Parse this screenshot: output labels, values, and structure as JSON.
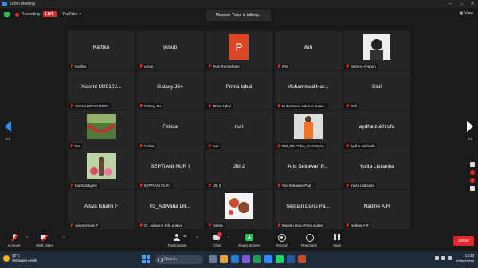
{
  "window": {
    "title": "Zoom Meeting"
  },
  "topbar": {
    "recording_label": "Recording",
    "live_label": "LIVE",
    "stream_target": "YouTube",
    "view_label": "View"
  },
  "talking_banner": "Munawir Yusuf is talking...",
  "pagination": {
    "left": "2/2",
    "right": "2/2"
  },
  "tiles": [
    {
      "name": "Kartika",
      "label": "Kartika",
      "thumb": null
    },
    {
      "name": "yusup",
      "label": "yusup",
      "thumb": null
    },
    {
      "name": "",
      "label": "Putri Ramadhani",
      "thumb": "letter-P"
    },
    {
      "name": "Win",
      "label": "Win",
      "thumb": null
    },
    {
      "name": "",
      "label": "Salmon Anggun",
      "thumb": "photo-woman"
    },
    {
      "name": "Xiaomi M2010J...",
      "label": "Xiaomi M2010J19SG",
      "thumb": null
    },
    {
      "name": "Galaxy J6+",
      "label": "Galaxy J6+",
      "thumb": null
    },
    {
      "name": "Prima Iqbal",
      "label": "Prima Iqbal",
      "thumb": null
    },
    {
      "name": "Muhammad Har...",
      "label": "Muhammad Haris Kurniaw...",
      "thumb": null
    },
    {
      "name": "Sisil",
      "label": "Sisil",
      "thumb": null
    },
    {
      "name": "",
      "label": "Era",
      "thumb": "photo-hammock"
    },
    {
      "name": "Felicia",
      "label": "Felicia",
      "thumb": null
    },
    {
      "name": "nuri",
      "label": "nuri",
      "thumb": null
    },
    {
      "name": "",
      "label": "003_SD PADA_RAHMAYA",
      "thumb": "photo-person-orange"
    },
    {
      "name": "aydha zukhrufa",
      "label": "aydha zukhrufa",
      "thumb": null
    },
    {
      "name": "",
      "label": "Lia Sulistyanti",
      "thumb": "photo-flowers"
    },
    {
      "name": "SEPTIANI NUR I",
      "label": "SEPTIANI NUR I",
      "thumb": null
    },
    {
      "name": "JBI 2",
      "label": "JBI 2",
      "thumb": null
    },
    {
      "name": "Aric Setiawan P...",
      "label": "Aric Setiawan Pad...",
      "thumb": null
    },
    {
      "name": "Yulita Listianita",
      "label": "Yulita Listianita",
      "thumb": null
    },
    {
      "name": "Aisya Isnaini F",
      "label": "Aisya Isnaini F",
      "thumb": null
    },
    {
      "name": "03_Adiwana Dif...",
      "label": "03_Adiwana Difa pratiya",
      "thumb": null
    },
    {
      "name": "",
      "label": "Salma",
      "thumb": "photo-bear"
    },
    {
      "name": "Septian Danu Pa...",
      "label": "Septian Danu Pamungkas",
      "thumb": null
    },
    {
      "name": "Nadine A.R",
      "label": "Nadine A.R",
      "thumb": null
    }
  ],
  "toolbar": {
    "unmute": "Unmute",
    "start_video": "Start Video",
    "participants": "Participants",
    "participants_count": "38",
    "chat": "Chat",
    "chat_badge": "1",
    "share_screen": "Share Screen",
    "record": "Record",
    "reactions": "Reactions",
    "apps": "Apps",
    "leave": "Leave"
  },
  "taskbar": {
    "temperature": "32°C",
    "weather_desc": "Sebagian cerah",
    "search_placeholder": "Search",
    "time": "13:23",
    "date": "07/06/2023"
  },
  "colors": {
    "accent_blue": "#2d8cff",
    "red": "#e02828",
    "green": "#23c552"
  }
}
